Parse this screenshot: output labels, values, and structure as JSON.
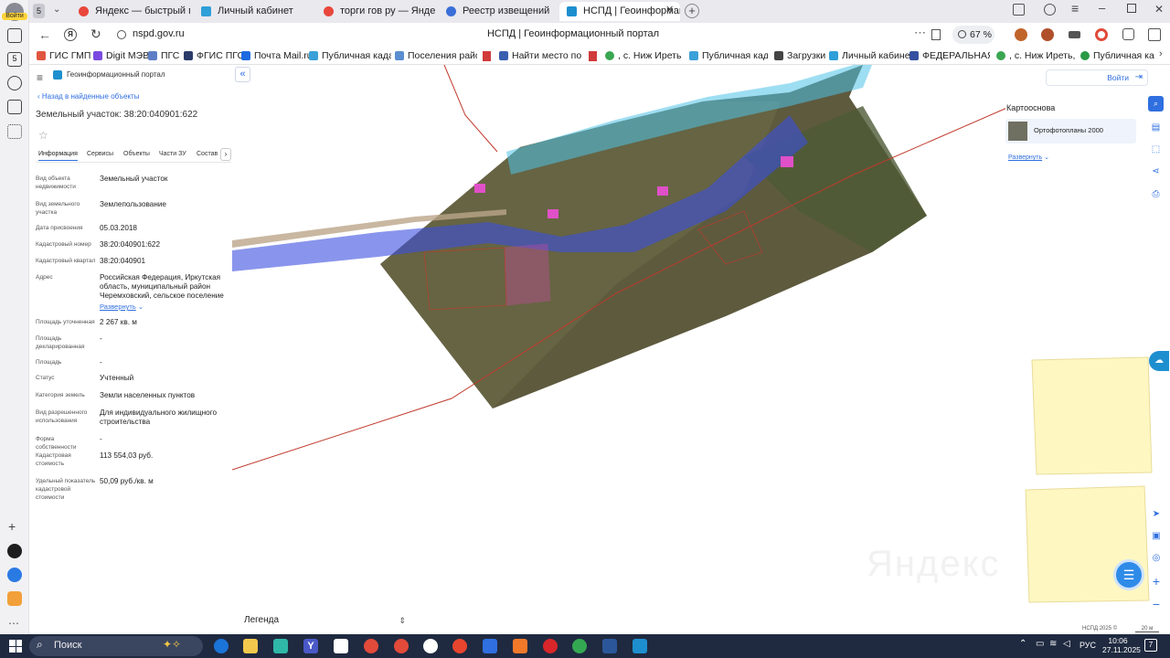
{
  "browser": {
    "rail_badge": "5",
    "rail_login": "Войти",
    "tabs": [
      {
        "count": "5"
      },
      {
        "label": "Яндекс — быстрый поиск"
      },
      {
        "label": "Личный кабинет"
      },
      {
        "label": "торги гов ру — Яндекс: на"
      },
      {
        "label": "Реестр извещений"
      },
      {
        "label": "НСПД | Геоинформац"
      }
    ],
    "url": "nspd.gov.ru",
    "page_title": "НСПД | Геоинформационный портал",
    "zoom": "67 %",
    "bookmarks": [
      "ГИС ГМП",
      "Digit МЭВ",
      "ПГС",
      "ФГИС ПГС",
      "Почта Mail.ru",
      "Публичная кадас",
      "Поселения район",
      "Найти место по к",
      ", с. Ниж Иреть, ул",
      "Публичная кадас",
      "Загрузки",
      "Личный кабинет",
      "ФЕДЕРАЛЬНАЯ И",
      ", с. Ниж Иреть, ул",
      "Публичная ка"
    ]
  },
  "panel": {
    "brand": "Геоинформационный портал",
    "back": "Назад в найденные объекты",
    "title": "Земельный участок: 38:20:040901:622",
    "tabs": [
      "Информация",
      "Сервисы",
      "Объекты",
      "Части ЗУ",
      "Состав"
    ],
    "fields": [
      {
        "label": "Вид объекта недвижимости",
        "value": "Земельный участок"
      },
      {
        "label": "Вид земельного участка",
        "value": "Землепользование"
      },
      {
        "label": "Дата присвоения",
        "value": "05.03.2018"
      },
      {
        "label": "Кадастровый номер",
        "value": "38:20:040901:622"
      },
      {
        "label": "Кадастровый квартал",
        "value": "38:20:040901"
      },
      {
        "label": "Адрес",
        "value": "Российская Федерация, Иркутская область, муниципальный район Черемховский, сельское поселение"
      },
      {
        "label": "Площадь уточненная",
        "value": "2 267 кв. м"
      },
      {
        "label": "Площадь декларированная",
        "value": "-"
      },
      {
        "label": "Площадь",
        "value": "-"
      },
      {
        "label": "Статус",
        "value": "Учтенный"
      },
      {
        "label": "Категория земель",
        "value": "Земли населенных пунктов"
      },
      {
        "label": "Вид разрешенного использования",
        "value": "Для индивидуального жилищного строительства"
      },
      {
        "label": "Форма собственности",
        "value": "-"
      },
      {
        "label": "Кадастровая стоимость",
        "value": "113 554,03 руб."
      },
      {
        "label": "Удельный показатель кадастровой стоимости",
        "value": "50,09 руб./кв. м"
      }
    ],
    "expand": "Развернуть"
  },
  "map": {
    "login": "Войти",
    "basemap_title": "Картооснова",
    "basemap_item": "Ортофотопланы 2000",
    "basemap_expand": "Развернуть",
    "legend": "Легенда",
    "watermark": "Яндекс",
    "footer_left": "НСПД 2025 ©",
    "footer_scale": "20 м"
  },
  "taskbar": {
    "search": "Поиск",
    "lang": "РУС",
    "time": "10:06",
    "date": "27.11.2025",
    "notif": "7"
  },
  "colors": {
    "accent": "#2f6fe0",
    "parcel_outline": "#c0392b",
    "zone_blue": "#3a4ee0",
    "parcel_yellow": "#fff7c2"
  }
}
